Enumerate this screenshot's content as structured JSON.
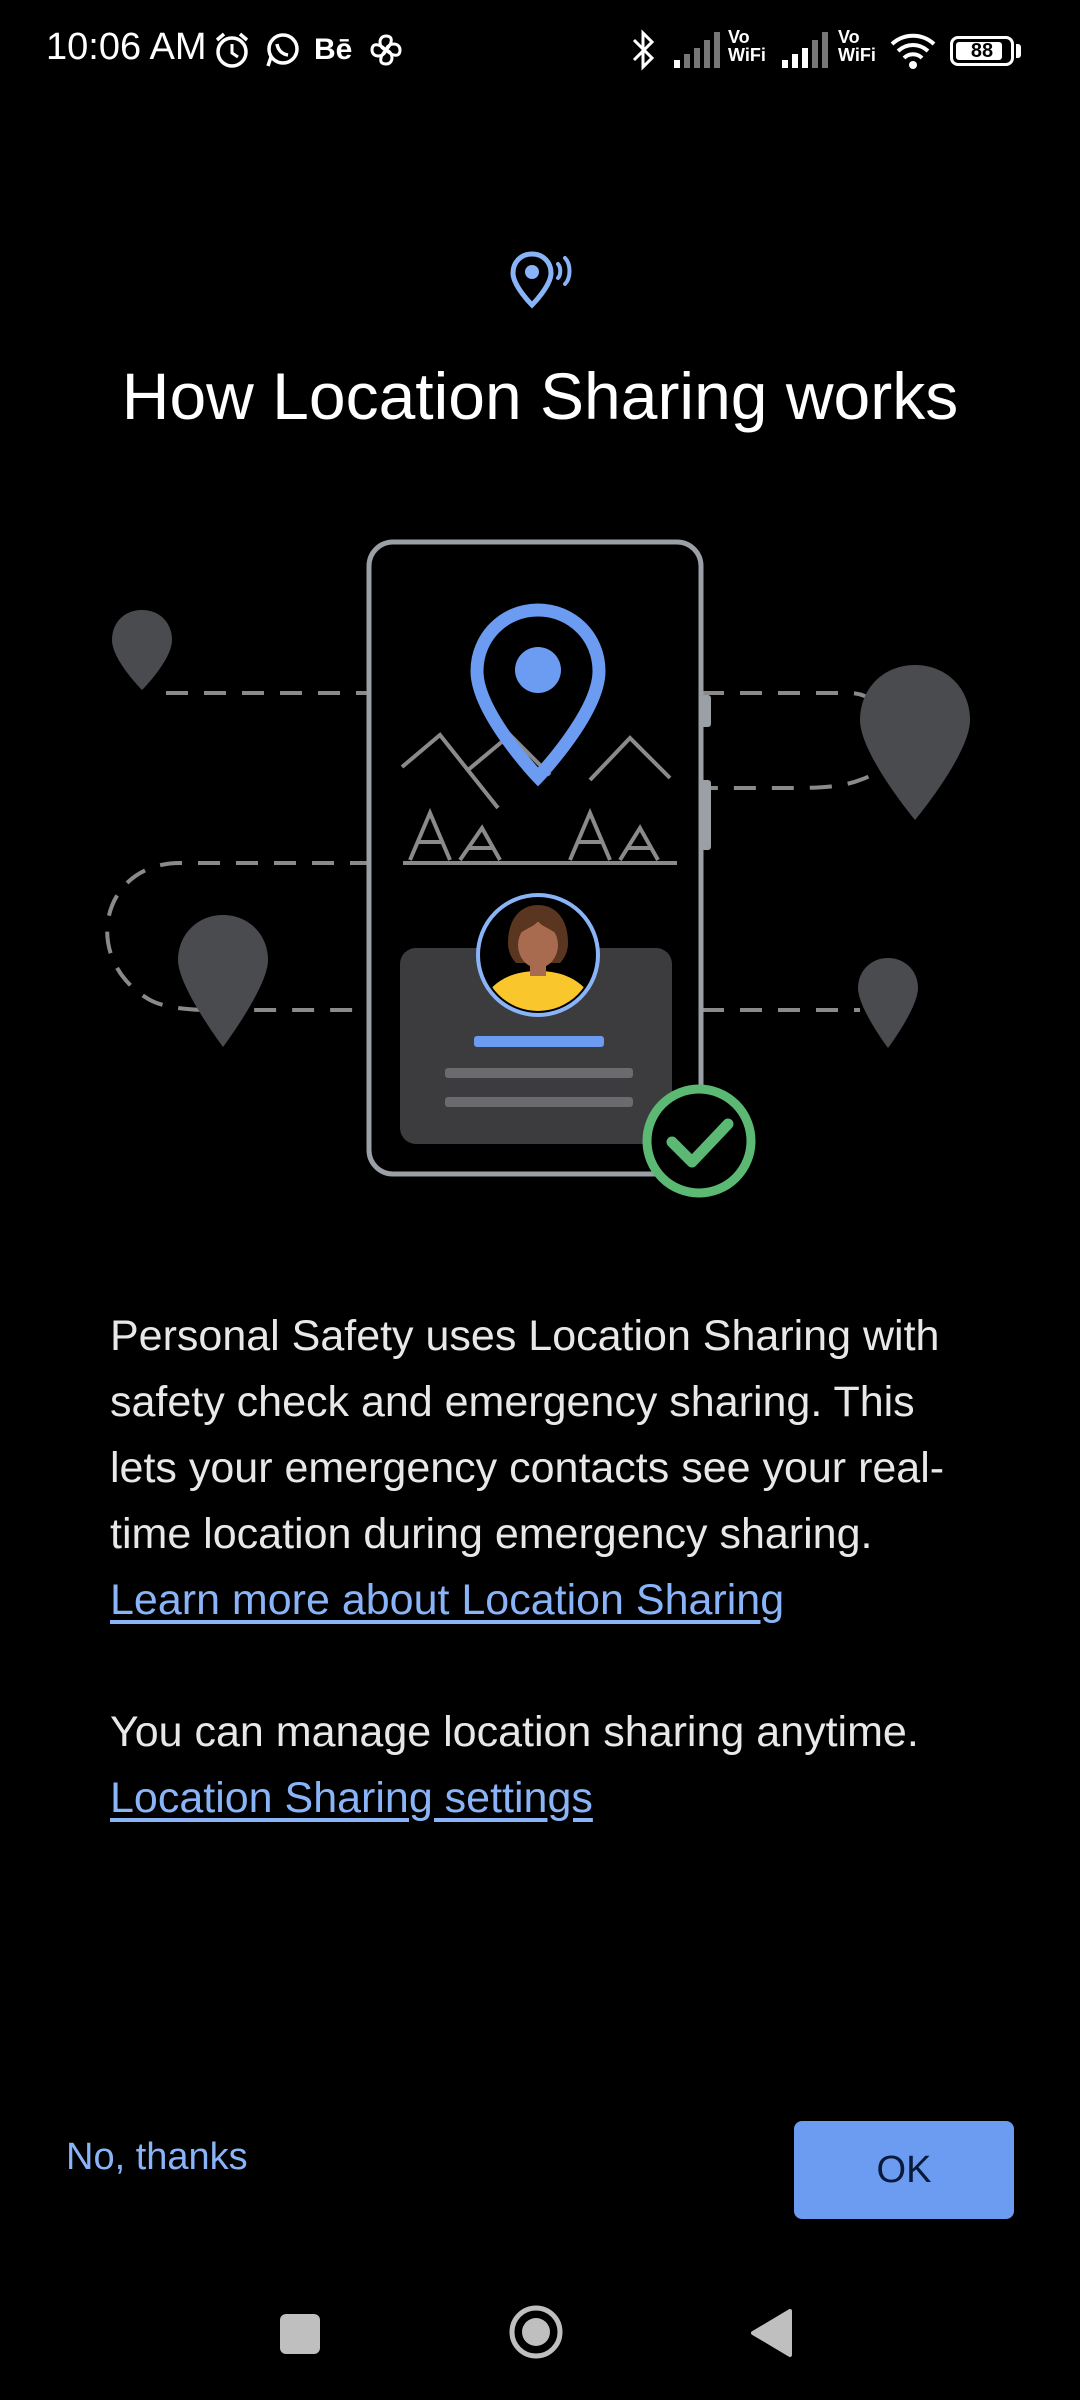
{
  "status_bar": {
    "time": "10:06 AM",
    "icons": [
      "alarm-icon",
      "whatsapp-icon",
      "behance-icon",
      "pinwheel-icon",
      "bluetooth-icon",
      "signal-icon",
      "vowifi-icon",
      "signal-icon",
      "vowifi-icon",
      "wifi-icon",
      "battery-icon"
    ],
    "vowifi_label_1": "Vo",
    "vowifi_label_2": "WiFi",
    "battery_level": "88"
  },
  "header": {
    "icon": "location-sharing-icon",
    "title": "How Location Sharing works"
  },
  "body": {
    "paragraph1_text": "Personal Safety uses Location Sharing with safety check and emergency sharing. This lets your emergency contacts see your real-time location during emergency sharing. ",
    "paragraph1_link": "Learn more about Location Sharing",
    "paragraph2_text": "You can manage location sharing anytime.",
    "paragraph2_link": "Location Sharing settings"
  },
  "actions": {
    "secondary_label": "No, thanks",
    "primary_label": "OK"
  },
  "colors": {
    "accent": "#8ab4f8",
    "button": "#6c9bf2",
    "background": "#000000",
    "check_green": "#5bb974"
  },
  "nav_bar": {
    "icons": [
      "recents-icon",
      "home-icon",
      "back-icon"
    ]
  }
}
